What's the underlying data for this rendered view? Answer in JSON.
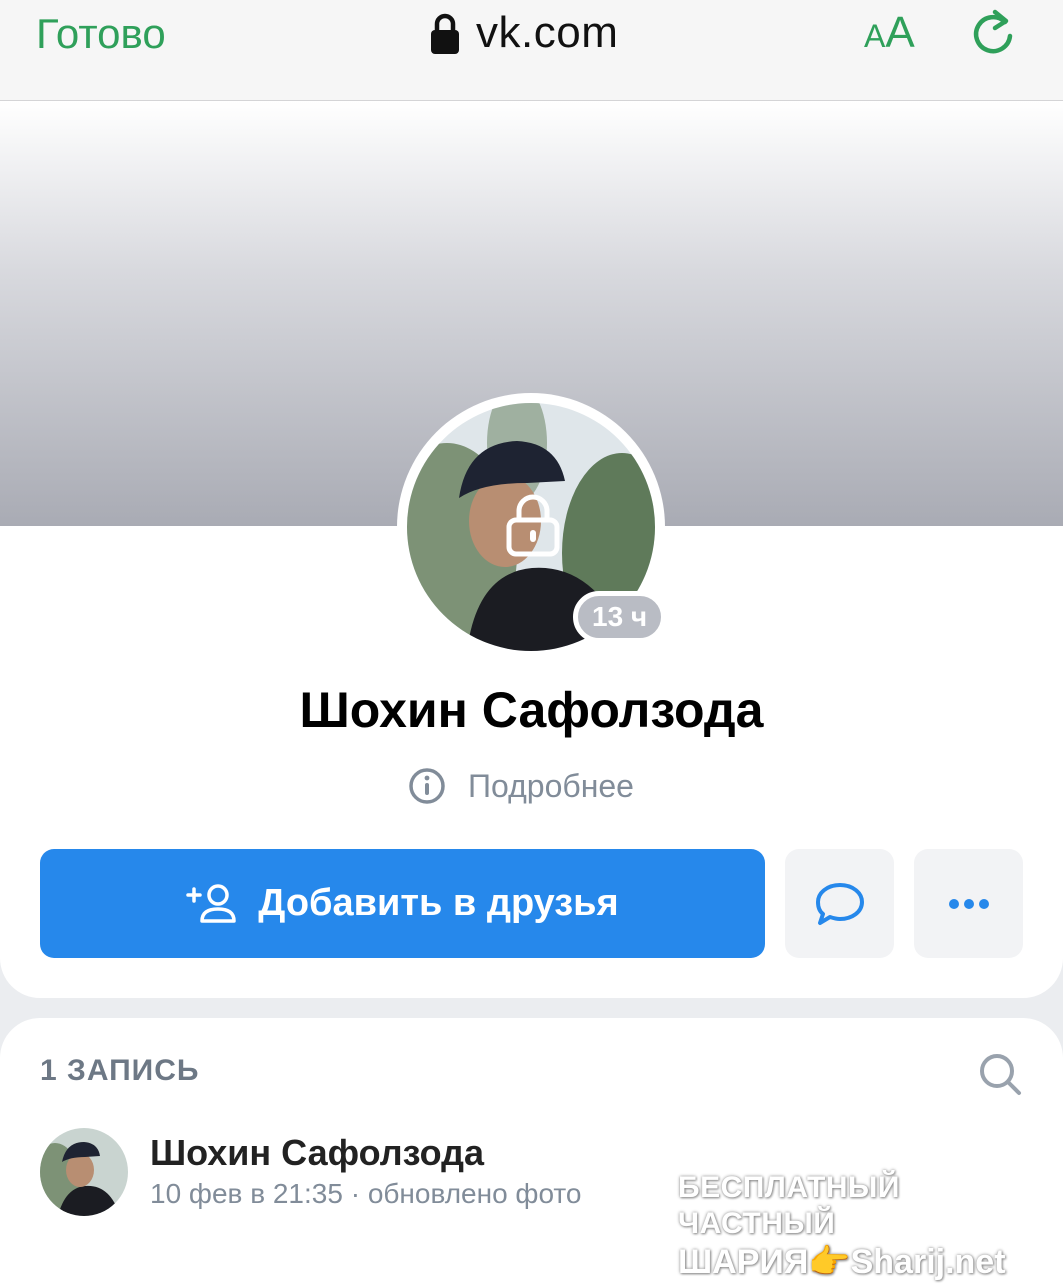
{
  "browser": {
    "done_label": "Готово",
    "url": "vk.com",
    "text_size_small": "A",
    "text_size_large": "A",
    "accent_color": "#2fa05a"
  },
  "profile": {
    "name": "Шохин Сафолзода",
    "last_seen": "13 ч",
    "details_label": "Подробнее",
    "add_friend_label": "Добавить в друзья",
    "primary_color": "#2688eb"
  },
  "posts": {
    "header": "1 ЗАПИСЬ",
    "items": [
      {
        "author": "Шохин Сафолзода",
        "date": "10 фев в 21:35",
        "separator": "·",
        "action": "обновлено фото"
      }
    ]
  },
  "watermark": {
    "line1": "БЕСПЛАТНЫЙ ЧАСТНЫЙ",
    "line2": "ШАРИЯ👉Sharij.net"
  },
  "icons": [
    "lock-icon",
    "reload-icon",
    "avatar-lock-icon",
    "info-icon",
    "add-user-icon",
    "message-icon",
    "more-icon",
    "search-icon"
  ]
}
